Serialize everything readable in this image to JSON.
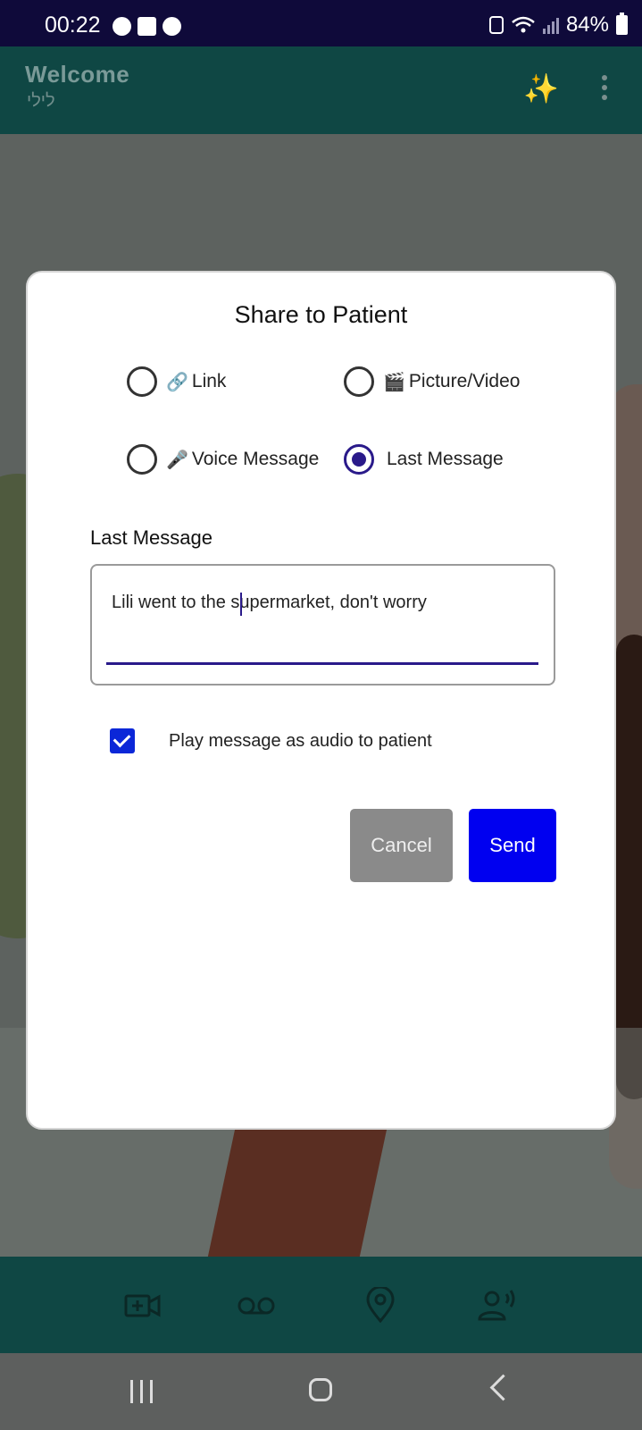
{
  "status_bar": {
    "time": "00:22",
    "battery": "84%",
    "notification_icons": [
      "messenger-icon",
      "gallery-icon",
      "whatsapp-icon"
    ]
  },
  "app_bar": {
    "title": "Welcome",
    "subtitle": "לילי"
  },
  "dialog": {
    "title": "Share to Patient",
    "options": [
      {
        "label": "Link",
        "icon": "🔗",
        "selected": false
      },
      {
        "label": "Picture/Video",
        "icon": "🎬",
        "selected": false
      },
      {
        "label": "Voice Message",
        "icon": "🎤",
        "selected": false
      },
      {
        "label": "Last Message",
        "icon": "",
        "selected": true
      }
    ],
    "field_label": "Last Message",
    "message_value": "Lili went to the supermarket, don't worry",
    "checkbox_label": "Play message as audio to patient",
    "checkbox_checked": true,
    "cancel_label": "Cancel",
    "send_label": "Send"
  },
  "bottom_nav": {
    "items": [
      "video-call-icon",
      "voicemail-icon",
      "location-icon",
      "voice-speaker-icon"
    ]
  },
  "colors": {
    "accent": "#2a1a8a",
    "send_button": "#0000f0",
    "cancel_button": "#8a8a8a",
    "app_bar": "#0f4744"
  }
}
